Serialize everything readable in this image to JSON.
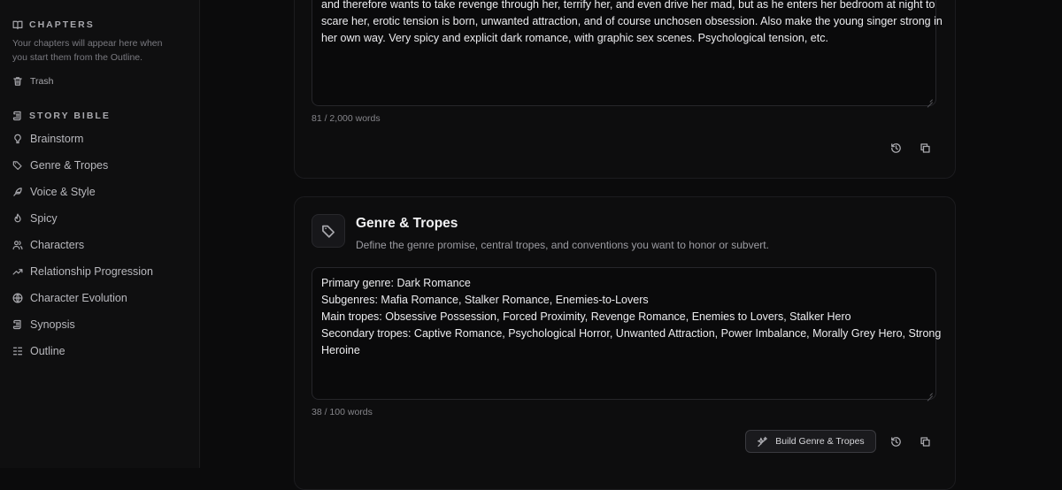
{
  "sidebar": {
    "chapters_heading": "CHAPTERS",
    "chapters_hint": "Your chapters will appear here when you start them from the Outline.",
    "trash_label": "Trash",
    "story_bible_heading": "STORY BIBLE",
    "items": [
      {
        "label": "Brainstorm",
        "icon": "lightbulb-icon"
      },
      {
        "label": "Genre & Tropes",
        "icon": "tag-icon"
      },
      {
        "label": "Voice & Style",
        "icon": "feather-icon"
      },
      {
        "label": "Spicy",
        "icon": "flame-icon"
      },
      {
        "label": "Characters",
        "icon": "users-icon"
      },
      {
        "label": "Relationship Progression",
        "icon": "trend-icon"
      },
      {
        "label": "Character Evolution",
        "icon": "globe-icon"
      },
      {
        "label": "Synopsis",
        "icon": "scroll-icon"
      },
      {
        "label": "Outline",
        "icon": "list-icon"
      }
    ]
  },
  "brainstorm_card": {
    "lines": [
      "and therefore wants to take revenge through her, terrify her, and even drive her mad, but as he enters her bedroom at night to",
      "scare her, erotic tension is born, unwanted attraction, and of course unchosen obsession. Also make the young singer strong in",
      "her own way. Very spicy and explicit dark romance, with graphic sex scenes. Psychological tension, etc."
    ],
    "word_count": "81 / 2,000 words"
  },
  "genre_card": {
    "title": "Genre & Tropes",
    "subtitle": "Define the genre promise, central tropes, and conventions you want to honor or subvert.",
    "lines": [
      "Primary genre: Dark Romance",
      "Subgenres: Mafia Romance, Stalker Romance, Enemies-to-Lovers",
      "Main tropes: Obsessive Possession, Forced Proximity, Revenge Romance, Enemies to Lovers, Stalker Hero",
      "Secondary tropes: Captive Romance, Psychological Horror, Unwanted Attraction, Power Imbalance, Morally Grey Hero, Strong",
      "Heroine"
    ],
    "word_count": "38 / 100 words",
    "build_button": "Build Genre & Tropes"
  },
  "colors": {
    "background": "#0b0b0c",
    "sidebar": "#0f0f10",
    "card": "#0d0d0e",
    "text": "#ececef",
    "muted": "#85858a"
  }
}
